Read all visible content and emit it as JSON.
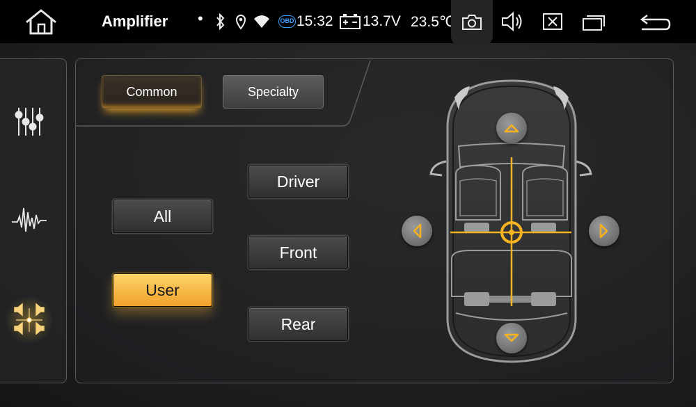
{
  "statusbar": {
    "title": "Amplifier",
    "dot": "•",
    "obd": "OBD",
    "time": "15:32",
    "voltage": "13.7V",
    "temperature": "23.5℃"
  },
  "sidebar": {
    "items": [
      {
        "icon": "equalizer-sliders-icon",
        "active": false
      },
      {
        "icon": "waveform-icon",
        "active": false
      },
      {
        "icon": "speaker-balance-icon",
        "active": true
      }
    ]
  },
  "tabs": {
    "common_label": "Common",
    "specialty_label": "Specialty",
    "active": "Common"
  },
  "modes": {
    "all_label": "All",
    "user_label": "User",
    "active": "User"
  },
  "positions": {
    "driver_label": "Driver",
    "front_label": "Front",
    "rear_label": "Rear"
  },
  "balance": {
    "fader": 0,
    "balance": 0
  },
  "colors": {
    "accent": "#f5b31f",
    "statusbar_bg": "#000000",
    "bluetooth_obd": "#3fa0ff"
  }
}
